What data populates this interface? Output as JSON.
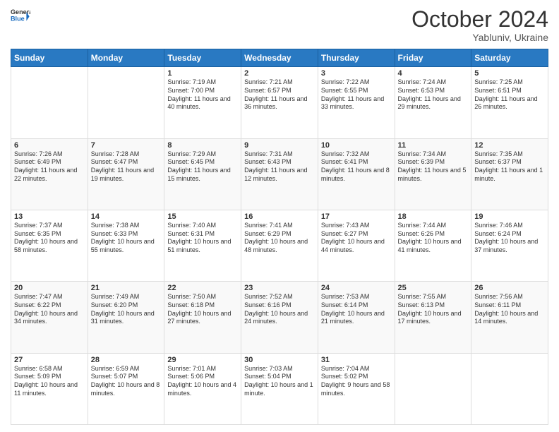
{
  "header": {
    "logo_line1": "General",
    "logo_line2": "Blue",
    "month_year": "October 2024",
    "location": "Yabluniv, Ukraine"
  },
  "days_of_week": [
    "Sunday",
    "Monday",
    "Tuesday",
    "Wednesday",
    "Thursday",
    "Friday",
    "Saturday"
  ],
  "weeks": [
    [
      {
        "day": "",
        "sunrise": "",
        "sunset": "",
        "daylight": ""
      },
      {
        "day": "",
        "sunrise": "",
        "sunset": "",
        "daylight": ""
      },
      {
        "day": "1",
        "sunrise": "Sunrise: 7:19 AM",
        "sunset": "Sunset: 7:00 PM",
        "daylight": "Daylight: 11 hours and 40 minutes."
      },
      {
        "day": "2",
        "sunrise": "Sunrise: 7:21 AM",
        "sunset": "Sunset: 6:57 PM",
        "daylight": "Daylight: 11 hours and 36 minutes."
      },
      {
        "day": "3",
        "sunrise": "Sunrise: 7:22 AM",
        "sunset": "Sunset: 6:55 PM",
        "daylight": "Daylight: 11 hours and 33 minutes."
      },
      {
        "day": "4",
        "sunrise": "Sunrise: 7:24 AM",
        "sunset": "Sunset: 6:53 PM",
        "daylight": "Daylight: 11 hours and 29 minutes."
      },
      {
        "day": "5",
        "sunrise": "Sunrise: 7:25 AM",
        "sunset": "Sunset: 6:51 PM",
        "daylight": "Daylight: 11 hours and 26 minutes."
      }
    ],
    [
      {
        "day": "6",
        "sunrise": "Sunrise: 7:26 AM",
        "sunset": "Sunset: 6:49 PM",
        "daylight": "Daylight: 11 hours and 22 minutes."
      },
      {
        "day": "7",
        "sunrise": "Sunrise: 7:28 AM",
        "sunset": "Sunset: 6:47 PM",
        "daylight": "Daylight: 11 hours and 19 minutes."
      },
      {
        "day": "8",
        "sunrise": "Sunrise: 7:29 AM",
        "sunset": "Sunset: 6:45 PM",
        "daylight": "Daylight: 11 hours and 15 minutes."
      },
      {
        "day": "9",
        "sunrise": "Sunrise: 7:31 AM",
        "sunset": "Sunset: 6:43 PM",
        "daylight": "Daylight: 11 hours and 12 minutes."
      },
      {
        "day": "10",
        "sunrise": "Sunrise: 7:32 AM",
        "sunset": "Sunset: 6:41 PM",
        "daylight": "Daylight: 11 hours and 8 minutes."
      },
      {
        "day": "11",
        "sunrise": "Sunrise: 7:34 AM",
        "sunset": "Sunset: 6:39 PM",
        "daylight": "Daylight: 11 hours and 5 minutes."
      },
      {
        "day": "12",
        "sunrise": "Sunrise: 7:35 AM",
        "sunset": "Sunset: 6:37 PM",
        "daylight": "Daylight: 11 hours and 1 minute."
      }
    ],
    [
      {
        "day": "13",
        "sunrise": "Sunrise: 7:37 AM",
        "sunset": "Sunset: 6:35 PM",
        "daylight": "Daylight: 10 hours and 58 minutes."
      },
      {
        "day": "14",
        "sunrise": "Sunrise: 7:38 AM",
        "sunset": "Sunset: 6:33 PM",
        "daylight": "Daylight: 10 hours and 55 minutes."
      },
      {
        "day": "15",
        "sunrise": "Sunrise: 7:40 AM",
        "sunset": "Sunset: 6:31 PM",
        "daylight": "Daylight: 10 hours and 51 minutes."
      },
      {
        "day": "16",
        "sunrise": "Sunrise: 7:41 AM",
        "sunset": "Sunset: 6:29 PM",
        "daylight": "Daylight: 10 hours and 48 minutes."
      },
      {
        "day": "17",
        "sunrise": "Sunrise: 7:43 AM",
        "sunset": "Sunset: 6:27 PM",
        "daylight": "Daylight: 10 hours and 44 minutes."
      },
      {
        "day": "18",
        "sunrise": "Sunrise: 7:44 AM",
        "sunset": "Sunset: 6:26 PM",
        "daylight": "Daylight: 10 hours and 41 minutes."
      },
      {
        "day": "19",
        "sunrise": "Sunrise: 7:46 AM",
        "sunset": "Sunset: 6:24 PM",
        "daylight": "Daylight: 10 hours and 37 minutes."
      }
    ],
    [
      {
        "day": "20",
        "sunrise": "Sunrise: 7:47 AM",
        "sunset": "Sunset: 6:22 PM",
        "daylight": "Daylight: 10 hours and 34 minutes."
      },
      {
        "day": "21",
        "sunrise": "Sunrise: 7:49 AM",
        "sunset": "Sunset: 6:20 PM",
        "daylight": "Daylight: 10 hours and 31 minutes."
      },
      {
        "day": "22",
        "sunrise": "Sunrise: 7:50 AM",
        "sunset": "Sunset: 6:18 PM",
        "daylight": "Daylight: 10 hours and 27 minutes."
      },
      {
        "day": "23",
        "sunrise": "Sunrise: 7:52 AM",
        "sunset": "Sunset: 6:16 PM",
        "daylight": "Daylight: 10 hours and 24 minutes."
      },
      {
        "day": "24",
        "sunrise": "Sunrise: 7:53 AM",
        "sunset": "Sunset: 6:14 PM",
        "daylight": "Daylight: 10 hours and 21 minutes."
      },
      {
        "day": "25",
        "sunrise": "Sunrise: 7:55 AM",
        "sunset": "Sunset: 6:13 PM",
        "daylight": "Daylight: 10 hours and 17 minutes."
      },
      {
        "day": "26",
        "sunrise": "Sunrise: 7:56 AM",
        "sunset": "Sunset: 6:11 PM",
        "daylight": "Daylight: 10 hours and 14 minutes."
      }
    ],
    [
      {
        "day": "27",
        "sunrise": "Sunrise: 6:58 AM",
        "sunset": "Sunset: 5:09 PM",
        "daylight": "Daylight: 10 hours and 11 minutes."
      },
      {
        "day": "28",
        "sunrise": "Sunrise: 6:59 AM",
        "sunset": "Sunset: 5:07 PM",
        "daylight": "Daylight: 10 hours and 8 minutes."
      },
      {
        "day": "29",
        "sunrise": "Sunrise: 7:01 AM",
        "sunset": "Sunset: 5:06 PM",
        "daylight": "Daylight: 10 hours and 4 minutes."
      },
      {
        "day": "30",
        "sunrise": "Sunrise: 7:03 AM",
        "sunset": "Sunset: 5:04 PM",
        "daylight": "Daylight: 10 hours and 1 minute."
      },
      {
        "day": "31",
        "sunrise": "Sunrise: 7:04 AM",
        "sunset": "Sunset: 5:02 PM",
        "daylight": "Daylight: 9 hours and 58 minutes."
      },
      {
        "day": "",
        "sunrise": "",
        "sunset": "",
        "daylight": ""
      },
      {
        "day": "",
        "sunrise": "",
        "sunset": "",
        "daylight": ""
      }
    ]
  ]
}
